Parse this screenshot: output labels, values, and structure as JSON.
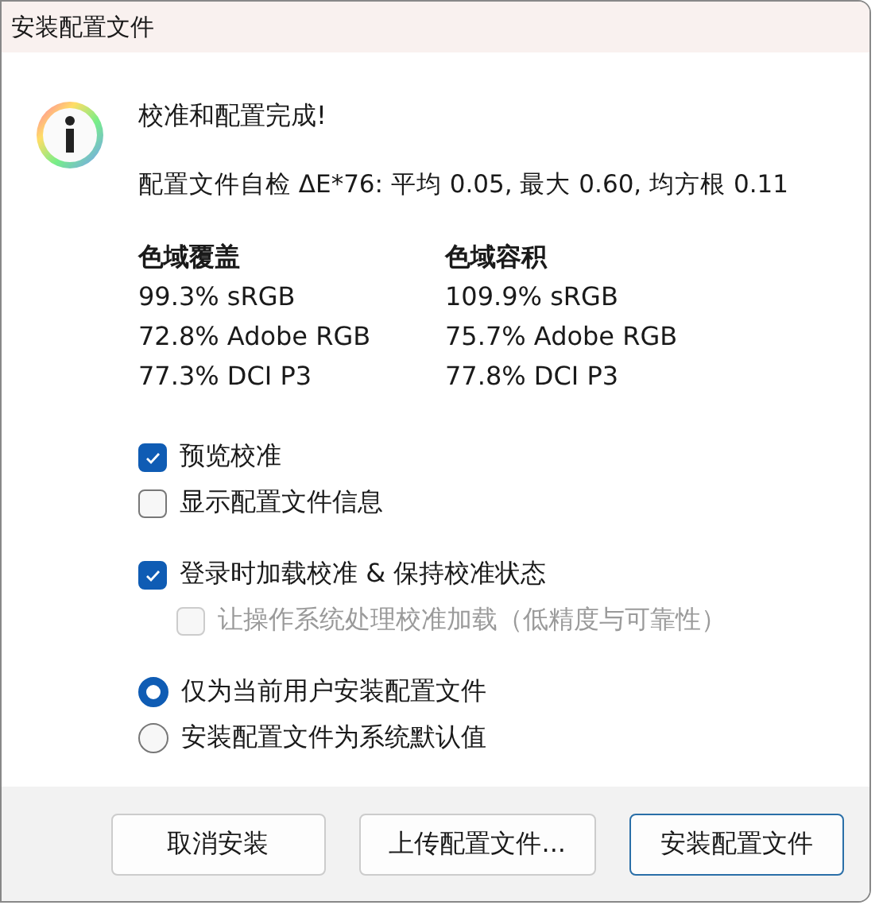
{
  "window": {
    "title": "安装配置文件"
  },
  "heading": "校准和配置完成!",
  "self_check": "配置文件自检 ΔE*76: 平均 0.05, 最大 0.60, 均方根 0.11",
  "gamut": [
    {
      "title": "色域覆盖",
      "lines": [
        "99.3% sRGB",
        "72.8% Adobe RGB",
        "77.3% DCI P3"
      ]
    },
    {
      "title": "色域容积",
      "lines": [
        "109.9% sRGB",
        "75.7% Adobe RGB",
        "77.8% DCI P3"
      ]
    }
  ],
  "option_groups": [
    [
      {
        "kind": "checkbox",
        "label": "预览校准",
        "checked": true,
        "disabled": false
      },
      {
        "kind": "checkbox",
        "label": "显示配置文件信息",
        "checked": false,
        "disabled": false
      }
    ],
    [
      {
        "kind": "checkbox",
        "label": "登录时加载校准 & 保持校准状态",
        "checked": true,
        "disabled": false,
        "children": [
          {
            "kind": "checkbox",
            "label": "让操作系统处理校准加载（低精度与可靠性）",
            "checked": false,
            "disabled": true
          }
        ]
      }
    ],
    [
      {
        "kind": "radio",
        "label": "仅为当前用户安装配置文件",
        "selected": true,
        "disabled": false
      },
      {
        "kind": "radio",
        "label": "安装配置文件为系统默认值",
        "selected": false,
        "disabled": false
      }
    ]
  ],
  "buttons": [
    {
      "label": "取消安装",
      "default": false
    },
    {
      "label": "上传配置文件...",
      "default": false
    },
    {
      "label": "安装配置文件",
      "default": true
    }
  ]
}
